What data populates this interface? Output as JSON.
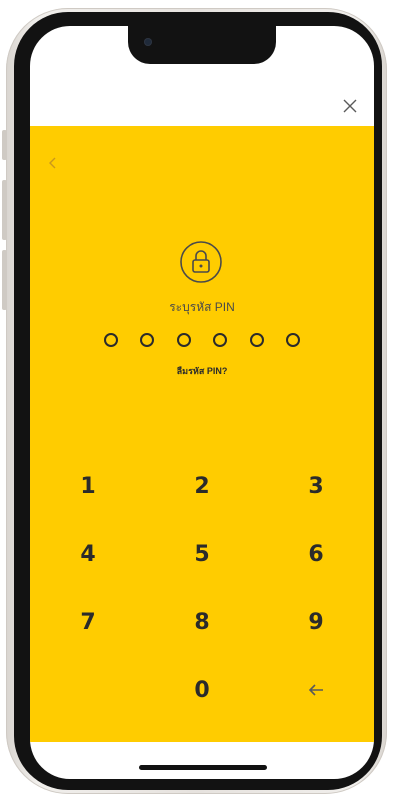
{
  "app": {
    "pin_title": "ระบุรหัส PIN",
    "forgot_pin": "ลืมรหัส PIN?",
    "pin_length": 6,
    "accent_color": "#ffcc00"
  },
  "icons": {
    "close": "close-icon",
    "back": "chevron-left-icon",
    "lock": "lock-icon",
    "backspace": "arrow-left-icon"
  },
  "keypad": {
    "k1": "1",
    "k2": "2",
    "k3": "3",
    "k4": "4",
    "k5": "5",
    "k6": "6",
    "k7": "7",
    "k8": "8",
    "k9": "9",
    "k0": "0"
  }
}
